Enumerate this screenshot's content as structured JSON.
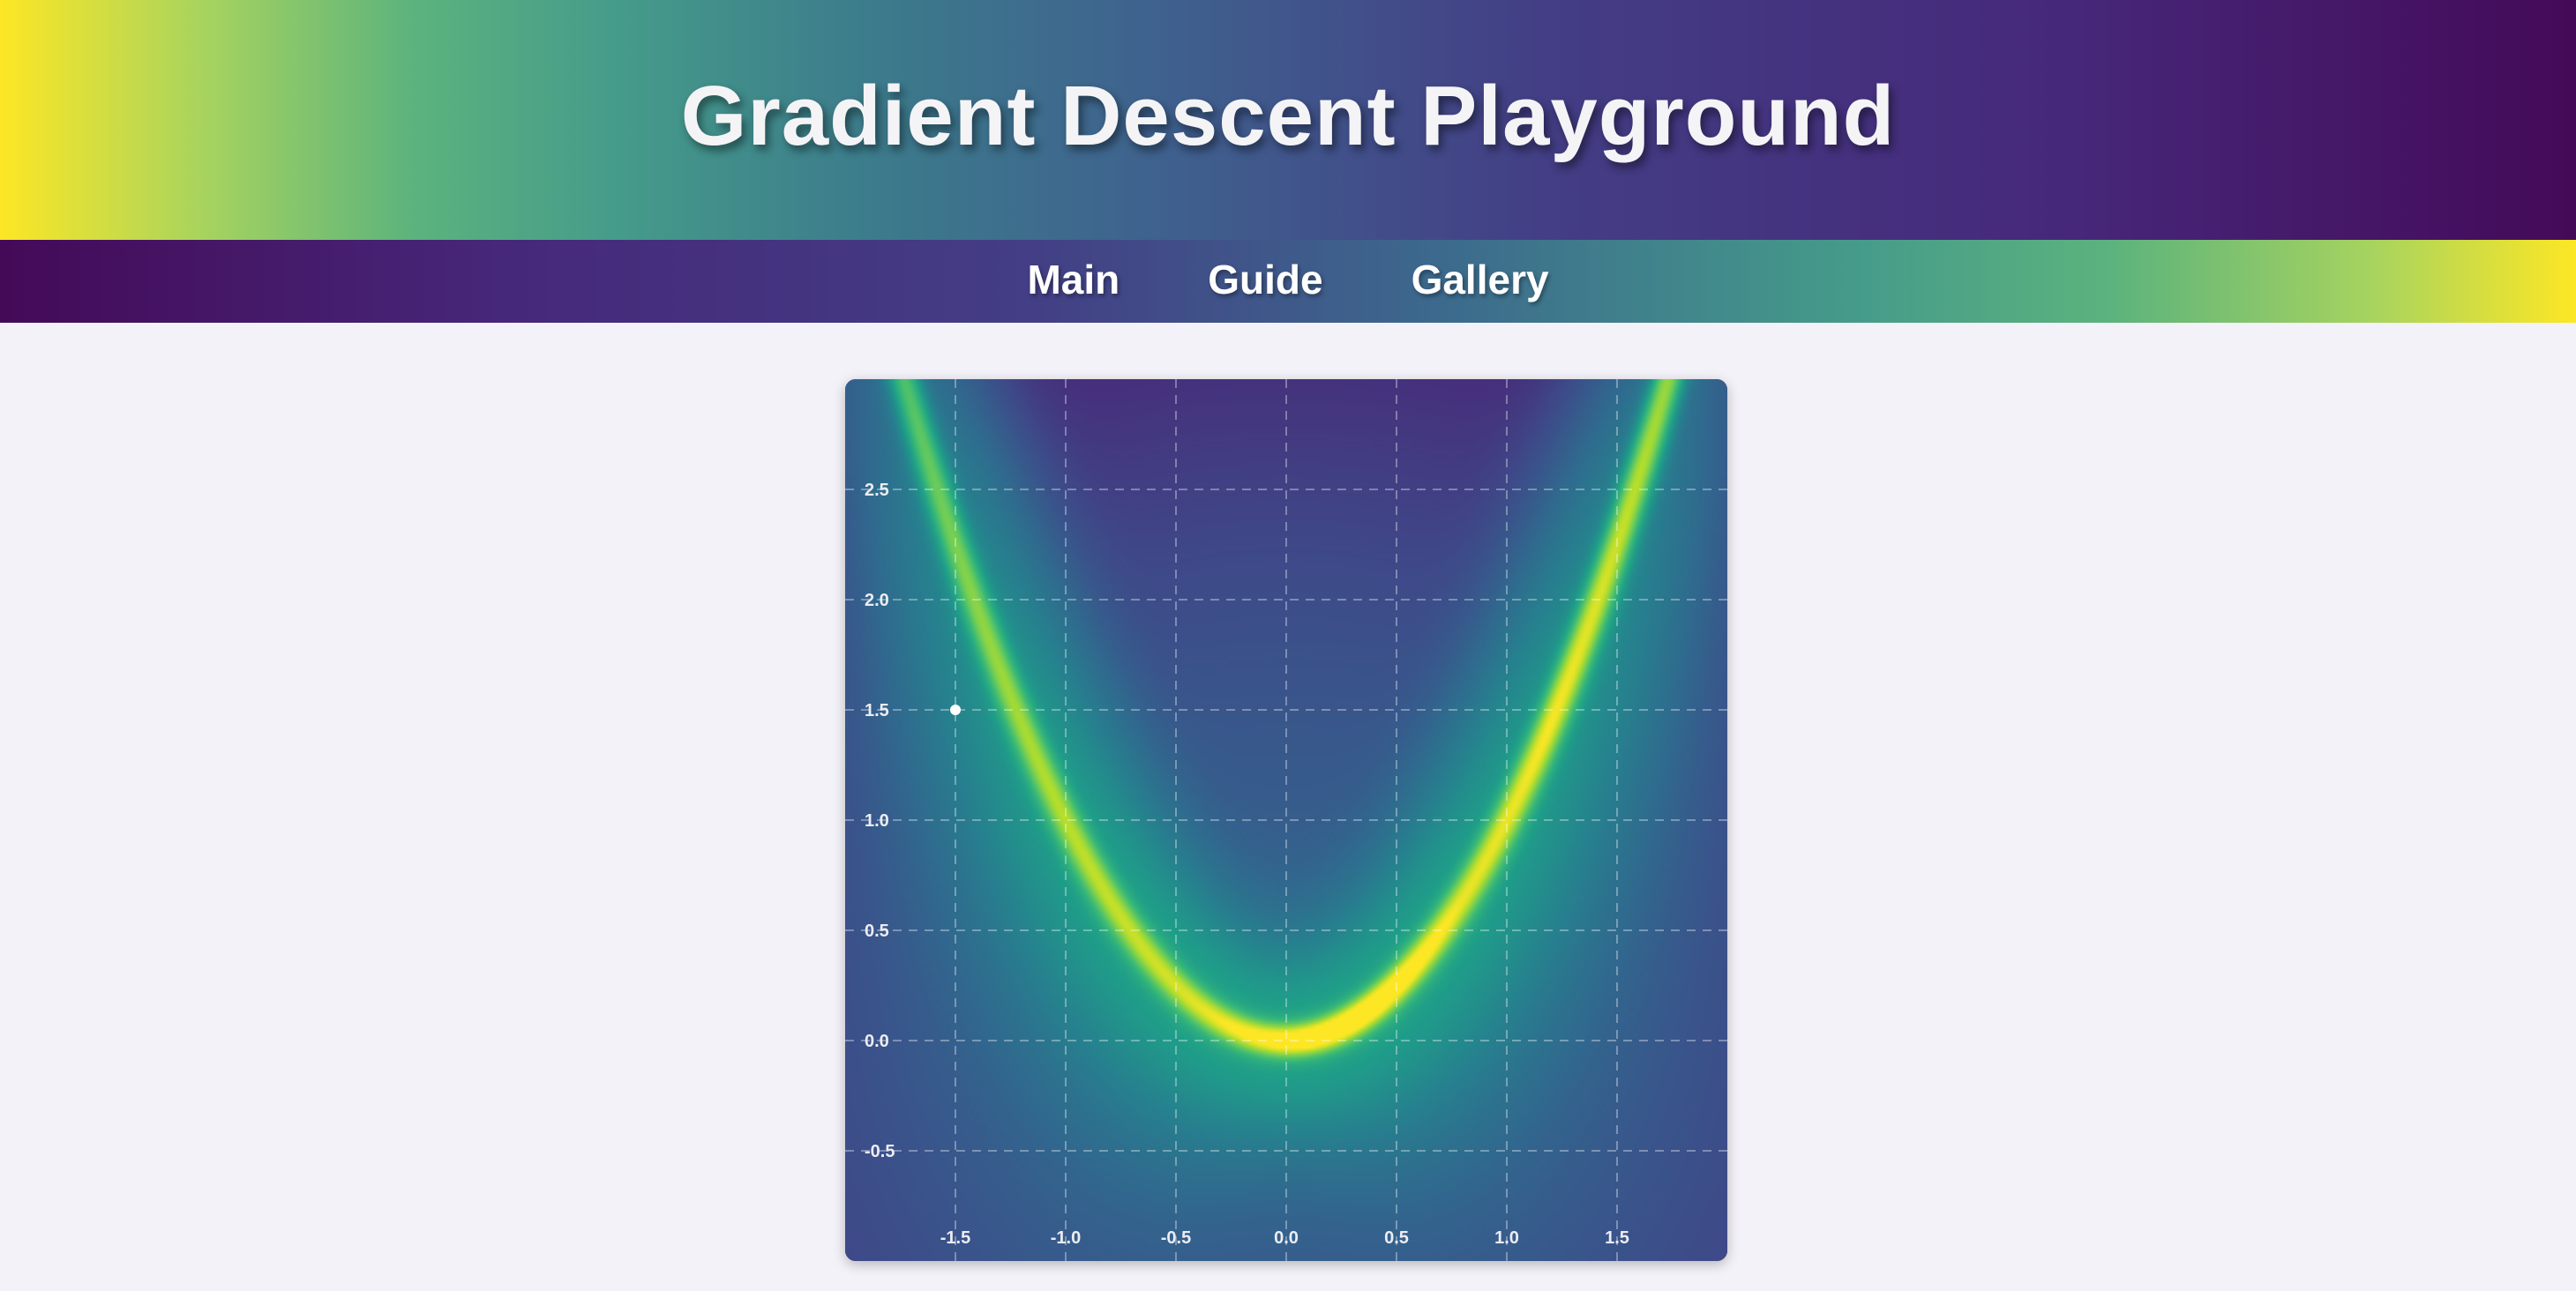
{
  "header": {
    "title": "Gradient Descent Playground"
  },
  "nav": {
    "items": [
      {
        "label": "Main"
      },
      {
        "label": "Guide"
      },
      {
        "label": "Gallery"
      }
    ]
  },
  "plot": {
    "function": "rosenbrock",
    "colormap": "viridis",
    "x_ticks": [
      "-1.5",
      "-1.0",
      "-0.5",
      "0.0",
      "0.5",
      "1.0",
      "1.5"
    ],
    "y_ticks": [
      "2.5",
      "2.0",
      "1.5",
      "1.0",
      "0.5",
      "0.0",
      "-0.5"
    ],
    "x_range": [
      -2.0,
      2.0
    ],
    "y_range": [
      -1.0,
      3.0
    ],
    "start_point": {
      "x": -1.5,
      "y": 1.5
    }
  }
}
